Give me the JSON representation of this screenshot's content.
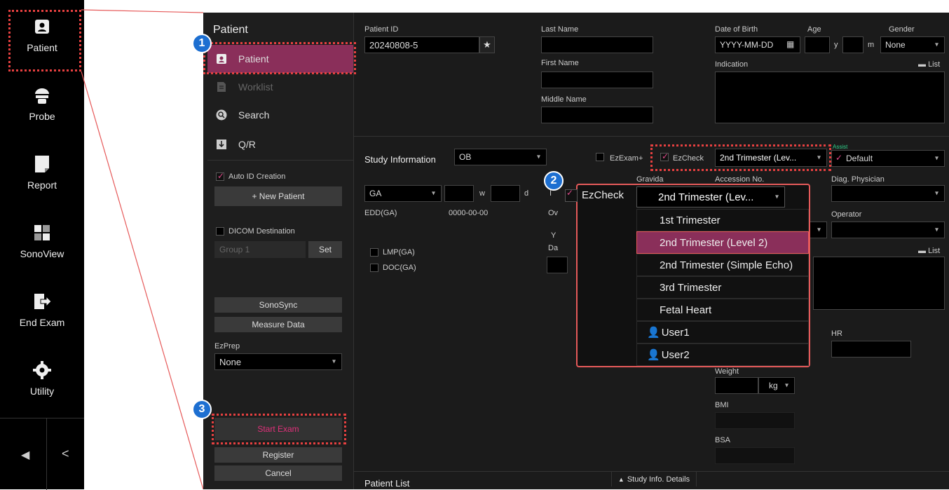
{
  "rail": {
    "items": [
      {
        "label": "Patient",
        "icon": "patient-icon"
      },
      {
        "label": "Probe",
        "icon": "probe-icon"
      },
      {
        "label": "Report",
        "icon": "report-icon"
      },
      {
        "label": "SonoView",
        "icon": "sonoview-icon"
      },
      {
        "label": "End Exam",
        "icon": "end-exam-icon"
      },
      {
        "label": "Utility",
        "icon": "gear-icon"
      }
    ],
    "arrow_left": "◀",
    "chevron_left": "<"
  },
  "panel": {
    "title": "Patient",
    "menu": [
      {
        "label": "Patient"
      },
      {
        "label": "Worklist"
      },
      {
        "label": "Search"
      },
      {
        "label": "Q/R"
      }
    ],
    "auto_id_label": "Auto ID Creation",
    "new_patient_label": "+ New Patient",
    "dicom_destination_label": "DICOM Destination",
    "group_value": "Group 1",
    "set_label": "Set",
    "sonosync_label": "SonoSync",
    "measure_data_label": "Measure Data",
    "ezprep_label": "EzPrep",
    "ezprep_value": "None",
    "start_exam_label": "Start Exam",
    "register_label": "Register",
    "cancel_label": "Cancel"
  },
  "patient": {
    "id_label": "Patient ID",
    "id_value": "20240808-5",
    "last_name_label": "Last Name",
    "first_name_label": "First Name",
    "middle_name_label": "Middle Name",
    "dob_label": "Date of Birth",
    "dob_placeholder": "YYYY-MM-DD",
    "age_label": "Age",
    "age_y": "y",
    "age_m": "m",
    "gender_label": "Gender",
    "gender_value": "None",
    "indication_label": "Indication",
    "list_label": "List"
  },
  "study": {
    "label": "Study Information",
    "type_value": "OB",
    "ezexam_label": "EzExam+",
    "ezcheck_label": "EzCheck",
    "ezcheck_value": "2nd Trimester (Lev...",
    "assist_label": "Assist",
    "default_value": "Default",
    "ga_value": "GA",
    "w_label": "w",
    "d_label": "d",
    "edd_label": "EDD(GA)",
    "edd_value": "0000-00-00",
    "lmp_label": "LMP(GA)",
    "doc_label": "DOC(GA)",
    "gravida_label": "Gravida",
    "accession_label": "Accession No.",
    "diag_physician_label": "Diag. Physician",
    "operator_label": "Operator",
    "list_label": "List",
    "hr_label": "HR",
    "weight_label": "Weight",
    "weight_unit": "kg",
    "bmi_label": "BMI",
    "bsa_label": "BSA",
    "es_no_partial": "es No.",
    "ov_partial": "Ov",
    "y_partial": "Y",
    "da_partial": "Da",
    "i_partial": "I"
  },
  "popup": {
    "ezcheck_label": "EzCheck",
    "selected": "2nd Trimester (Lev...",
    "options": [
      "1st Trimester",
      "2nd Trimester (Level 2)",
      "2nd Trimester (Simple Echo)",
      "3rd Trimester",
      "Fetal Heart",
      "User1",
      "User2"
    ]
  },
  "footer": {
    "patient_list_label": "Patient List",
    "study_details_label": "Study Info. Details"
  },
  "badges": [
    "1",
    "2",
    "3"
  ],
  "colors": {
    "accent": "#8a2f5a",
    "highlight": "#e64040",
    "badge": "#1d6fd1",
    "check": "#e04a8a",
    "assist": "#2fd08a"
  }
}
